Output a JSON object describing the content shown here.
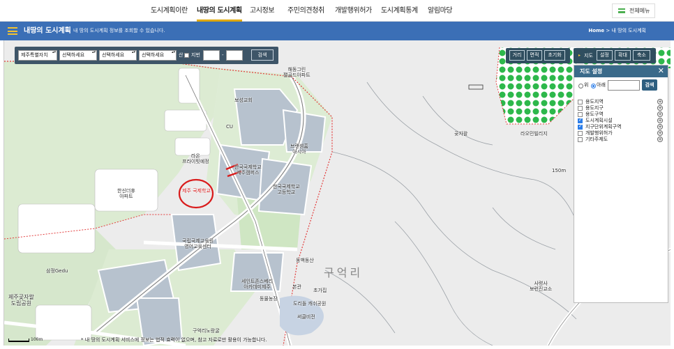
{
  "nav": {
    "items": [
      "도시계획이란",
      "내땅의 도시계획",
      "고시정보",
      "주민의견청취",
      "개발행위허가",
      "도시계획통계",
      "알림마당"
    ],
    "active": "내땅의 도시계획",
    "all_menu": "전체메뉴"
  },
  "header": {
    "title": "내땅의 도시계획",
    "subtitle": "내 땅의 도시계획 정보를 조회할 수 있습니다.",
    "breadcrumb_home": "Home",
    "breadcrumb_sep": ">",
    "breadcrumb_current": "내 땅의 도시계획"
  },
  "search": {
    "region": "제주특별자치",
    "select1": "선택하세요",
    "select2": "선택하세요",
    "select3": "선택하세요",
    "san_label": "산",
    "jibun_label": "지번",
    "dash": "-",
    "search_button": "검색"
  },
  "tools": {
    "distance": "거리",
    "area": "면적",
    "reset": "초기화",
    "map_label": "지도",
    "settings": "설정",
    "zoom_in": "확대",
    "zoom_out": "축소"
  },
  "settings_panel": {
    "title": "지도 설정",
    "radio_up": "위",
    "radio_down": "아래",
    "search_button": "검색",
    "layers": [
      {
        "label": "용도지역",
        "checked": false
      },
      {
        "label": "용도지구",
        "checked": false
      },
      {
        "label": "용도구역",
        "checked": false
      },
      {
        "label": "도시계획시설",
        "checked": true
      },
      {
        "label": "지구단위계획구역",
        "checked": true
      },
      {
        "label": "개발행위허가",
        "checked": false
      },
      {
        "label": "기타주제도",
        "checked": false
      }
    ]
  },
  "map_labels": {
    "l1": "해동그린\n팰골드아파트",
    "l2": "브랜셈홈\n아시아",
    "l3": "한국국제학교\n제주캠퍼스",
    "l4": "한국국제학교\n고등학교",
    "l5": "라온\n프라이빗예정",
    "l6": "한신더휴\n아파트",
    "l7": "국립국제교육원\n영어교육센터",
    "l8": "세인트존스베리\n아카데미제주",
    "l9": "제주곶자왈\n도립공원",
    "l10": "삼정Gedu",
    "l11": "구억리",
    "l12": "곶자왈",
    "l13": "라오민빌리지",
    "l14": "동백동산",
    "l15": "초가집",
    "l16": "본관",
    "l17": "동물농장",
    "l18": "도리돌 캐쉬공원",
    "l19": "써클비전",
    "l20": "사령사\n보련진교소",
    "l21": "150m",
    "l22": "CU",
    "l23": "제주 국제학교",
    "l24": "구억리노랑굴",
    "l25": "보성교회"
  },
  "scale_label": "100m",
  "notice": "* 내 땅의 도시계획 서비스에 정보는 법적 효력이 없으며, 참고 자료로만 활용이 가능합니다."
}
